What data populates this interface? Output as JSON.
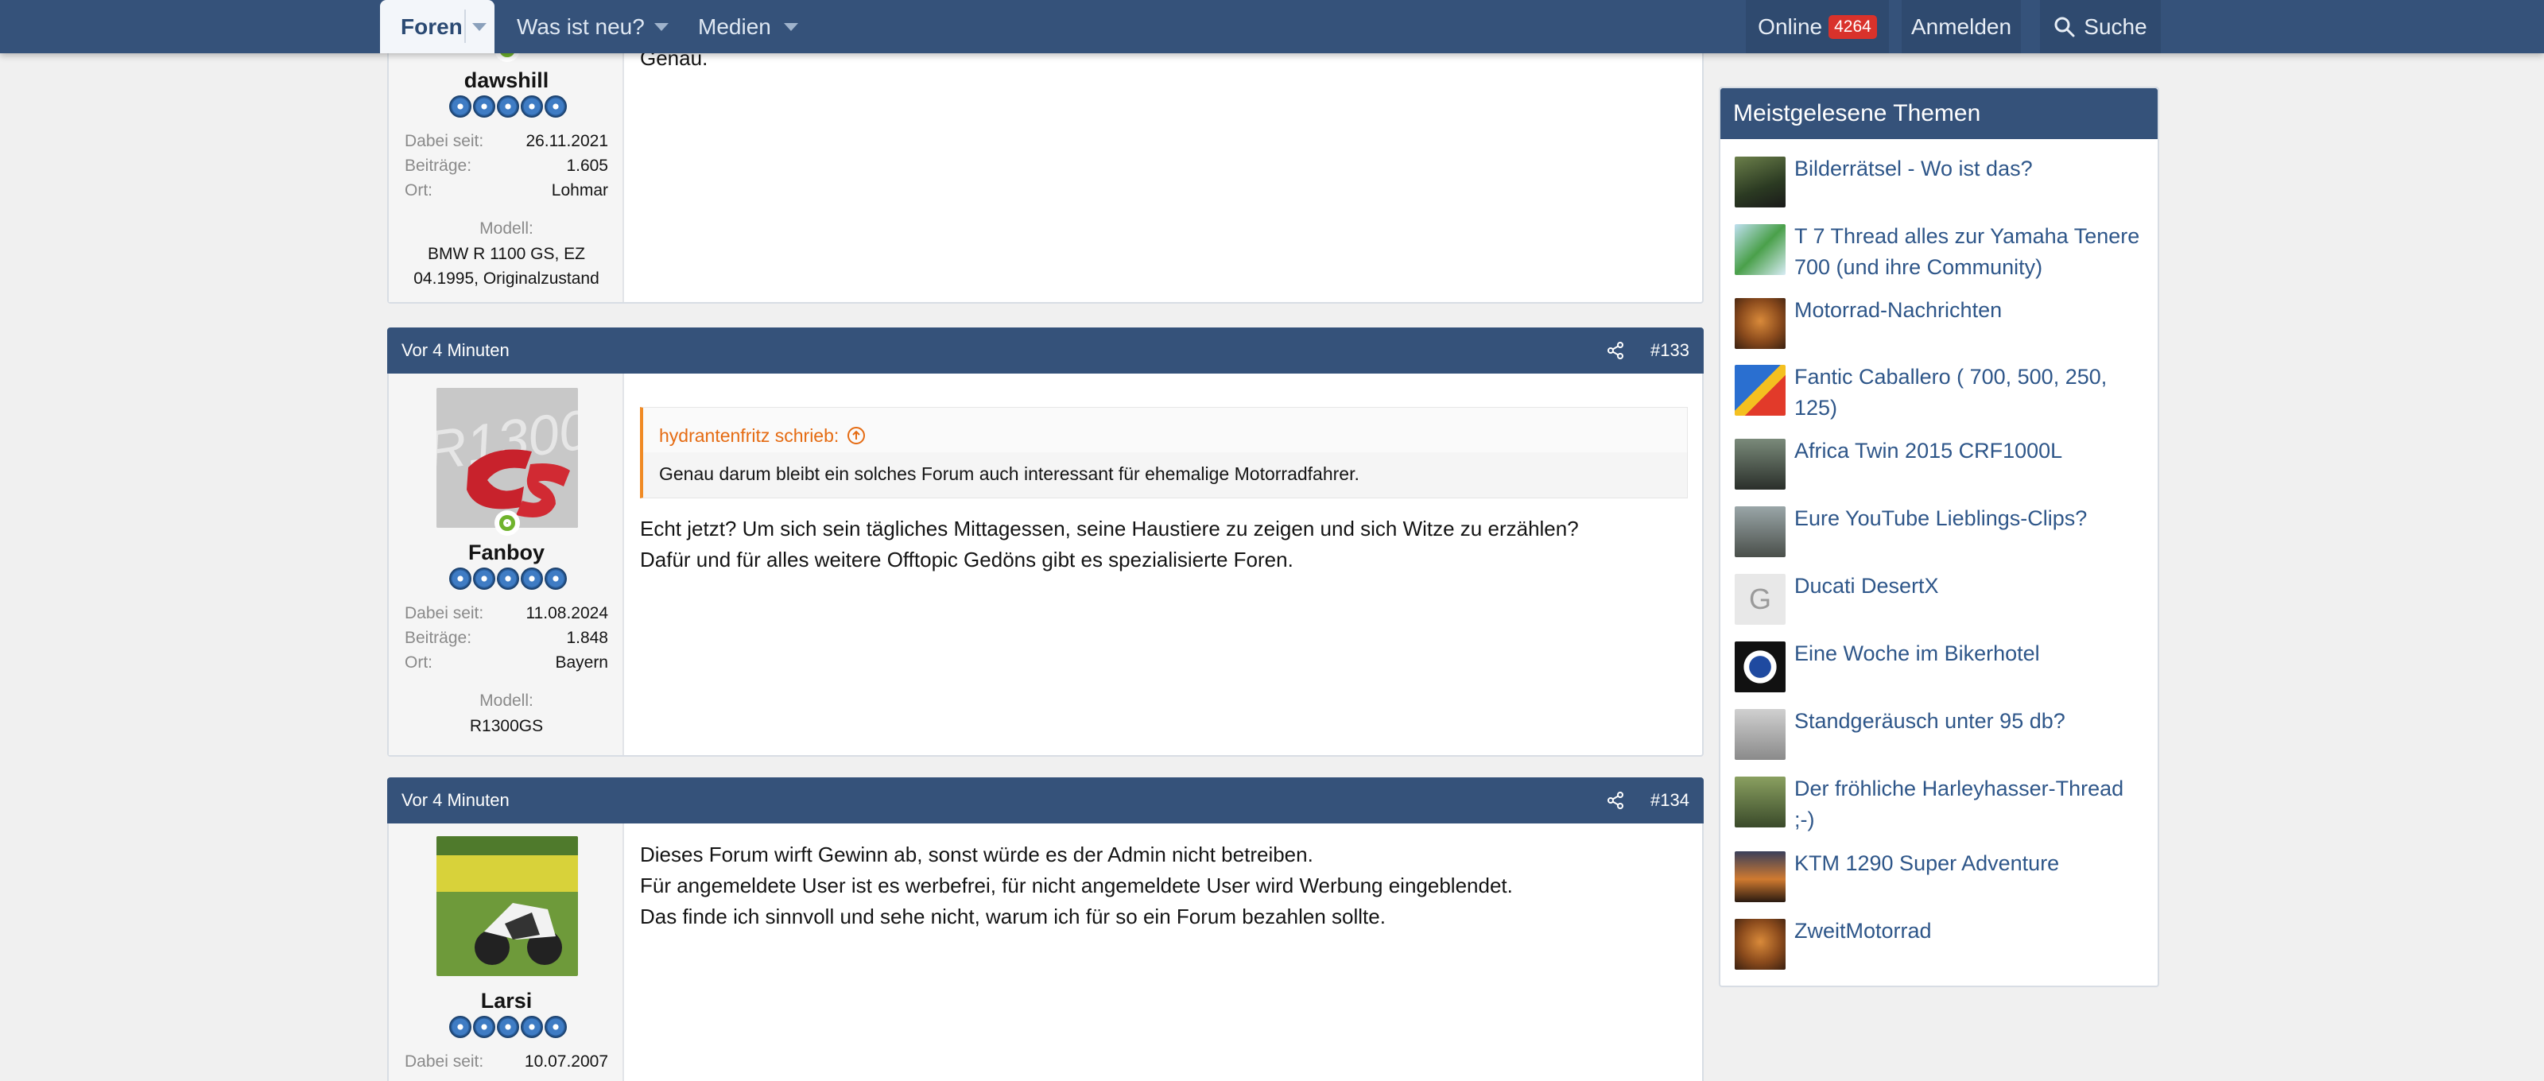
{
  "nav": {
    "forums": "Foren",
    "whats_new": "Was ist neu?",
    "media": "Medien",
    "online_label": "Online",
    "online_count": "4264",
    "login": "Anmelden",
    "search": "Suche"
  },
  "posts": [
    {
      "user": "dawshill",
      "fields": [
        {
          "k": "Dabei seit:",
          "v": "26.11.2021"
        },
        {
          "k": "Beiträge:",
          "v": "1.605"
        },
        {
          "k": "Ort:",
          "v": "Lohmar"
        }
      ],
      "model_label": "Modell:",
      "model_lines": [
        "BMW R 1100 GS, EZ",
        "04.1995, Originalzustand"
      ],
      "text": "Genau."
    },
    {
      "time": "Vor 4 Minuten",
      "number": "#133",
      "user": "Fanboy",
      "fields": [
        {
          "k": "Dabei seit:",
          "v": "11.08.2024"
        },
        {
          "k": "Beiträge:",
          "v": "1.848"
        },
        {
          "k": "Ort:",
          "v": "Bayern"
        }
      ],
      "model_label": "Modell:",
      "model_lines": [
        "R1300GS"
      ],
      "quote_author": "hydrantenfritz schrieb:",
      "quote_text": "Genau darum bleibt ein solches Forum auch interessant für ehemalige Motorradfahrer.",
      "lines": [
        "Echt jetzt? Um sich sein tägliches Mittagessen, seine Haustiere zu zeigen und sich Witze zu erzählen?",
        "Dafür und für alles weitere Offtopic Gedöns gibt es spezialisierte Foren."
      ]
    },
    {
      "time": "Vor 4 Minuten",
      "number": "#134",
      "user": "Larsi",
      "fields": [
        {
          "k": "Dabei seit:",
          "v": "10.07.2007"
        }
      ],
      "lines": [
        "Dieses Forum wirft Gewinn ab, sonst würde es der Admin nicht betreiben.",
        "Für angemeldete User ist es werbefrei, für nicht angemeldete User wird Werbung eingeblendet.",
        "Das finde ich sinnvoll und sehe nicht, warum ich für so ein Forum bezahlen sollte."
      ]
    }
  ],
  "sidebar": {
    "title": "Meistgelesene Themen",
    "items": [
      {
        "label": "Bilderrätsel - Wo ist das?"
      },
      {
        "label": "T 7 Thread alles zur Yamaha Tenere 700 (und ihre Community)"
      },
      {
        "label": "Motorrad-Nachrichten"
      },
      {
        "label": "Fantic Caballero ( 700, 500, 250, 125)"
      },
      {
        "label": "Africa Twin 2015 CRF1000L"
      },
      {
        "label": "Eure YouTube Lieblings-Clips?"
      },
      {
        "label": "Ducati DesertX",
        "initial": "G"
      },
      {
        "label": "Eine Woche im Bikerhotel"
      },
      {
        "label": "Standgeräusch unter 95 db?"
      },
      {
        "label": "Der fröhliche Harleyhasser-Thread ;-)"
      },
      {
        "label": "KTM 1290 Super Adventure"
      },
      {
        "label": "ZweitMotorrad"
      }
    ]
  }
}
